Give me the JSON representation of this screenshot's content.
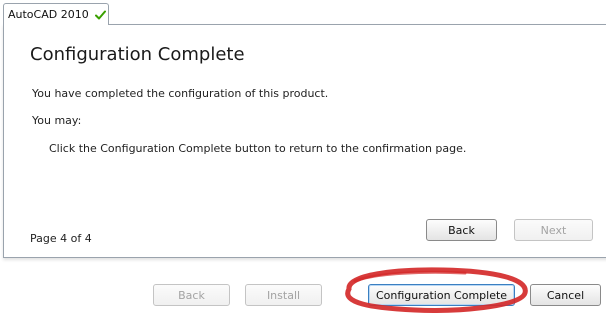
{
  "tab": {
    "label": "AutoCAD 2010",
    "status_icon": "checkmark-icon",
    "status_color": "#3aa000"
  },
  "content": {
    "title": "Configuration Complete",
    "line1": "You have completed the configuration of this product.",
    "line2": "You may:",
    "line3": "Click the Configuration Complete button to return to the confirmation page.",
    "page_indicator": "Page 4 of 4"
  },
  "panel_buttons": {
    "back": "Back",
    "next": "Next"
  },
  "footer_buttons": {
    "back": "Back",
    "install": "Install",
    "configuration_complete": "Configuration Complete",
    "cancel": "Cancel"
  },
  "highlight_color": "#d42a2a"
}
